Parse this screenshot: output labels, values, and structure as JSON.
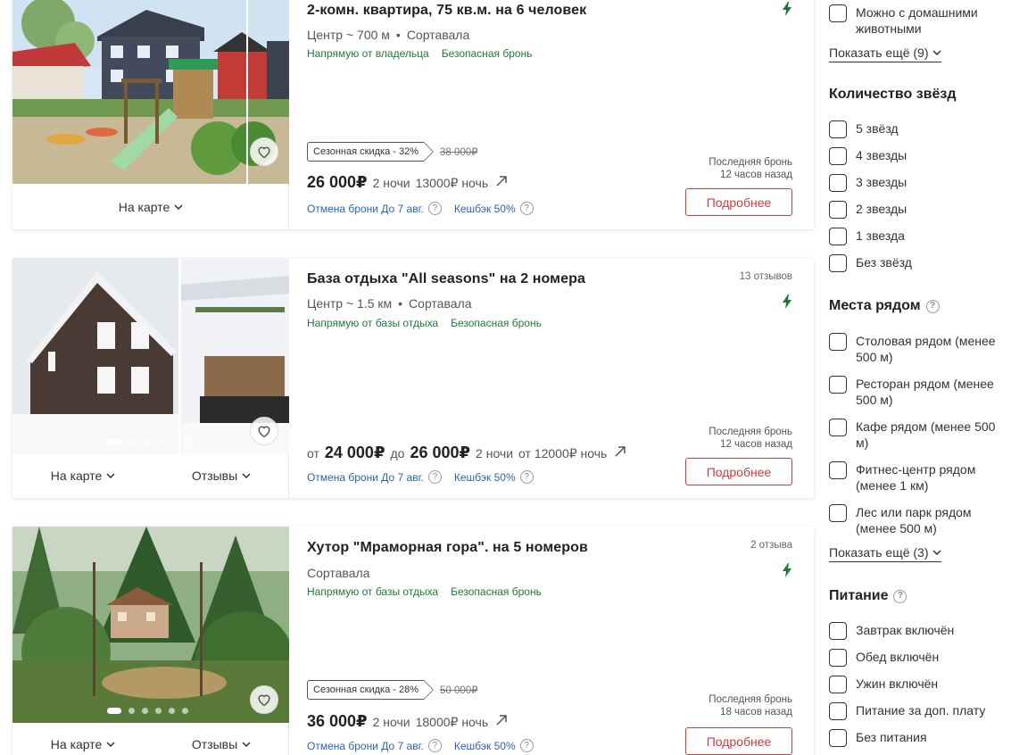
{
  "listings": [
    {
      "title": "2-комн. квартира, 75 кв.м. на 6 человек",
      "distance": "Центр ~ 700 м",
      "city": "Сортавала",
      "badge_owner": "Напрямую от владельца",
      "badge_safe": "Безопасная бронь",
      "discount_label": "Сезонная скидка - 32%",
      "old_price": "38 000₽",
      "price": "26 000₽",
      "nights": "2 ночи",
      "per_night": "13000₽ ночь",
      "cancel": "Отмена брони До 7 авг.",
      "cashback": "Кешбэк 50%",
      "last_booking_label": "Последняя бронь",
      "last_booking_time": "12 часов назад",
      "details": "Подробнее",
      "map": "На карте"
    },
    {
      "title": "База отдыха \"All seasons\" на 2 номера",
      "distance": "Центр ~ 1.5 км",
      "city": "Сортавала",
      "reviews_count": "13 отзывов",
      "badge_owner": "Напрямую от базы отдыха",
      "badge_safe": "Безопасная бронь",
      "price_from_label": "от",
      "price_from": "24 000₽",
      "price_to_label": "до",
      "price_to": "26 000₽",
      "nights": "2 ночи",
      "per_night": "от 12000₽ ночь",
      "cancel": "Отмена брони До 7 авг.",
      "cashback": "Кешбэк 50%",
      "last_booking_label": "Последняя бронь",
      "last_booking_time": "12 часов назад",
      "details": "Подробнее",
      "map": "На карте",
      "reviews_link": "Отзывы"
    },
    {
      "title": "Хутор \"Мраморная гора\". на 5 номеров",
      "city": "Сортавала",
      "reviews_count": "2 отзыва",
      "badge_owner": "Напрямую от базы отдыха",
      "badge_safe": "Безопасная бронь",
      "discount_label": "Сезонная скидка - 28%",
      "old_price": "50 000₽",
      "price": "36 000₽",
      "nights": "2 ночи",
      "per_night": "18000₽ ночь",
      "cancel": "Отмена брони До 7 авг.",
      "cashback": "Кешбэк 50%",
      "last_booking_label": "Последняя бронь",
      "last_booking_time": "18 часов назад",
      "details": "Подробнее",
      "map": "На карте",
      "reviews_link": "Отзывы"
    }
  ],
  "sidebar": {
    "pets": "Можно с домашними животными",
    "show_more_1": "Показать ещё (9)",
    "stars_title": "Количество звёзд",
    "stars": [
      "5 звёзд",
      "4 звезды",
      "3 звезды",
      "2 звезды",
      "1 звезда",
      "Без звёзд"
    ],
    "nearby_title": "Места рядом",
    "nearby": [
      "Столовая рядом (менее 500 м)",
      "Ресторан рядом (менее 500 м)",
      "Кафе рядом (менее 500 м)",
      "Фитнес-центр рядом (менее 1 км)",
      "Лес или парк рядом (менее 500 м)"
    ],
    "show_more_2": "Показать ещё (3)",
    "food_title": "Питание",
    "food": [
      "Завтрак включён",
      "Обед включён",
      "Ужин включён",
      "Питание за доп. плату",
      "Без питания"
    ]
  },
  "colors": {
    "accent_red": "#d23c3c",
    "badge_green": "#1f7a3a",
    "link_blue": "#2a64b5"
  }
}
